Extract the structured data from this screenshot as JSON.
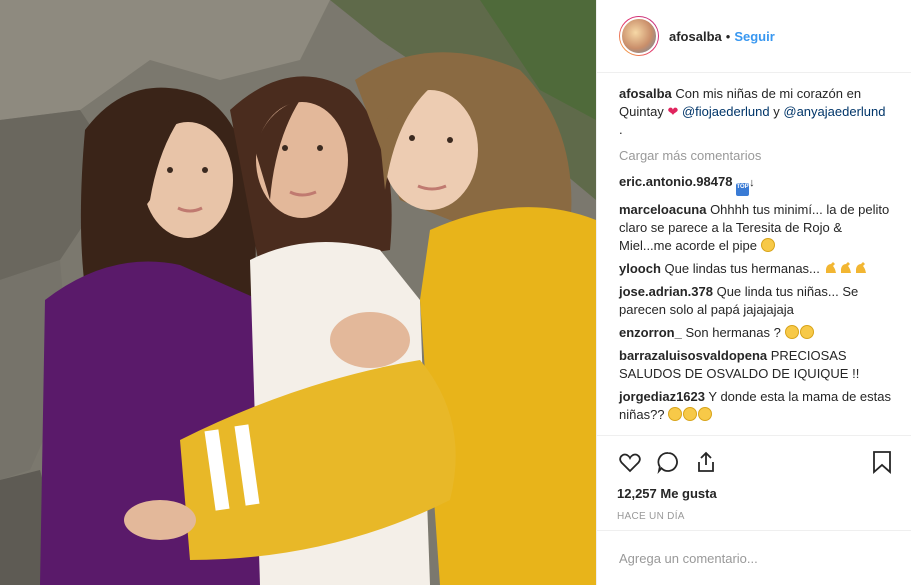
{
  "header": {
    "username": "afosalba",
    "separator": "•",
    "follow_label": "Seguir"
  },
  "caption": {
    "username": "afosalba",
    "text_1": "Con mis niñas de mi corazón en Quintay",
    "mention_1": "@fiojaederlund",
    "text_2": "y",
    "mention_2": "@anyajaederlund",
    "text_3": "."
  },
  "load_more_label": "Cargar más comentarios",
  "comments": [
    {
      "user": "eric.antonio.98478",
      "text": "",
      "emoji": "top-arrow-icon"
    },
    {
      "user": "marceloacuna",
      "text": "Ohhhh tus minimí... la de pelito claro se parece a la Teresita de Rojo & Miel...me acorde el pipe",
      "emoji": "sad-face-icon"
    },
    {
      "user": "ylooch",
      "text": "Que lindas tus hermanas...",
      "emoji": "flexed-biceps-icon x3"
    },
    {
      "user": "jose.adrian.378",
      "text": "Que linda tus niñas... Se parecen solo al papá jajajajaja",
      "emoji": ""
    },
    {
      "user": "enzorron_",
      "text": "Son hermanas ?",
      "emoji": "smirk-face-icon x2"
    },
    {
      "user": "barrazaluisosvaldopena",
      "text": "PRECIOSAS SALUDOS DE OSVALDO DE IQUIQUE !!",
      "emoji": ""
    },
    {
      "user": "jorgediaz1623",
      "text": "Y donde esta la mama de estas niñas??",
      "emoji": "smile-face-icon x3"
    }
  ],
  "likes_label": "12,257 Me gusta",
  "time_label": "HACE UN DÍA",
  "add_comment_placeholder": "Agrega un comentario...",
  "colors": {
    "accent": "#3897f0",
    "mention": "#003569",
    "heart": "#e0245e",
    "muted": "#999999"
  }
}
